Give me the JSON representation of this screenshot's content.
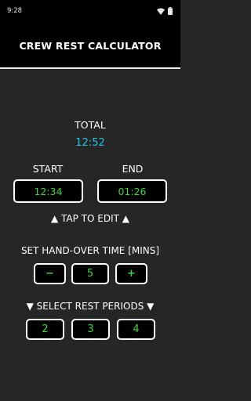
{
  "status_bar": {
    "time": "9:28",
    "icons": [
      "wifi-icon",
      "battery-icon"
    ]
  },
  "app": {
    "title": "CREW REST CALCULATOR"
  },
  "total": {
    "label": "TOTAL",
    "value": "12:52"
  },
  "start": {
    "label": "START",
    "value": "12:34"
  },
  "end": {
    "label": "END",
    "value": "01:26"
  },
  "tap_hint": "▲ TAP TO EDIT ▲",
  "handover": {
    "label": "SET HAND-OVER TIME [MINS]",
    "minus": "−",
    "value": "5",
    "plus": "+"
  },
  "rest_periods": {
    "label": "▼ SELECT REST PERIODS ▼",
    "options": [
      "2",
      "3",
      "4"
    ]
  },
  "colors": {
    "accent_green": "#3ed63e",
    "total_cyan": "#23c4ec",
    "background": "#262626"
  }
}
